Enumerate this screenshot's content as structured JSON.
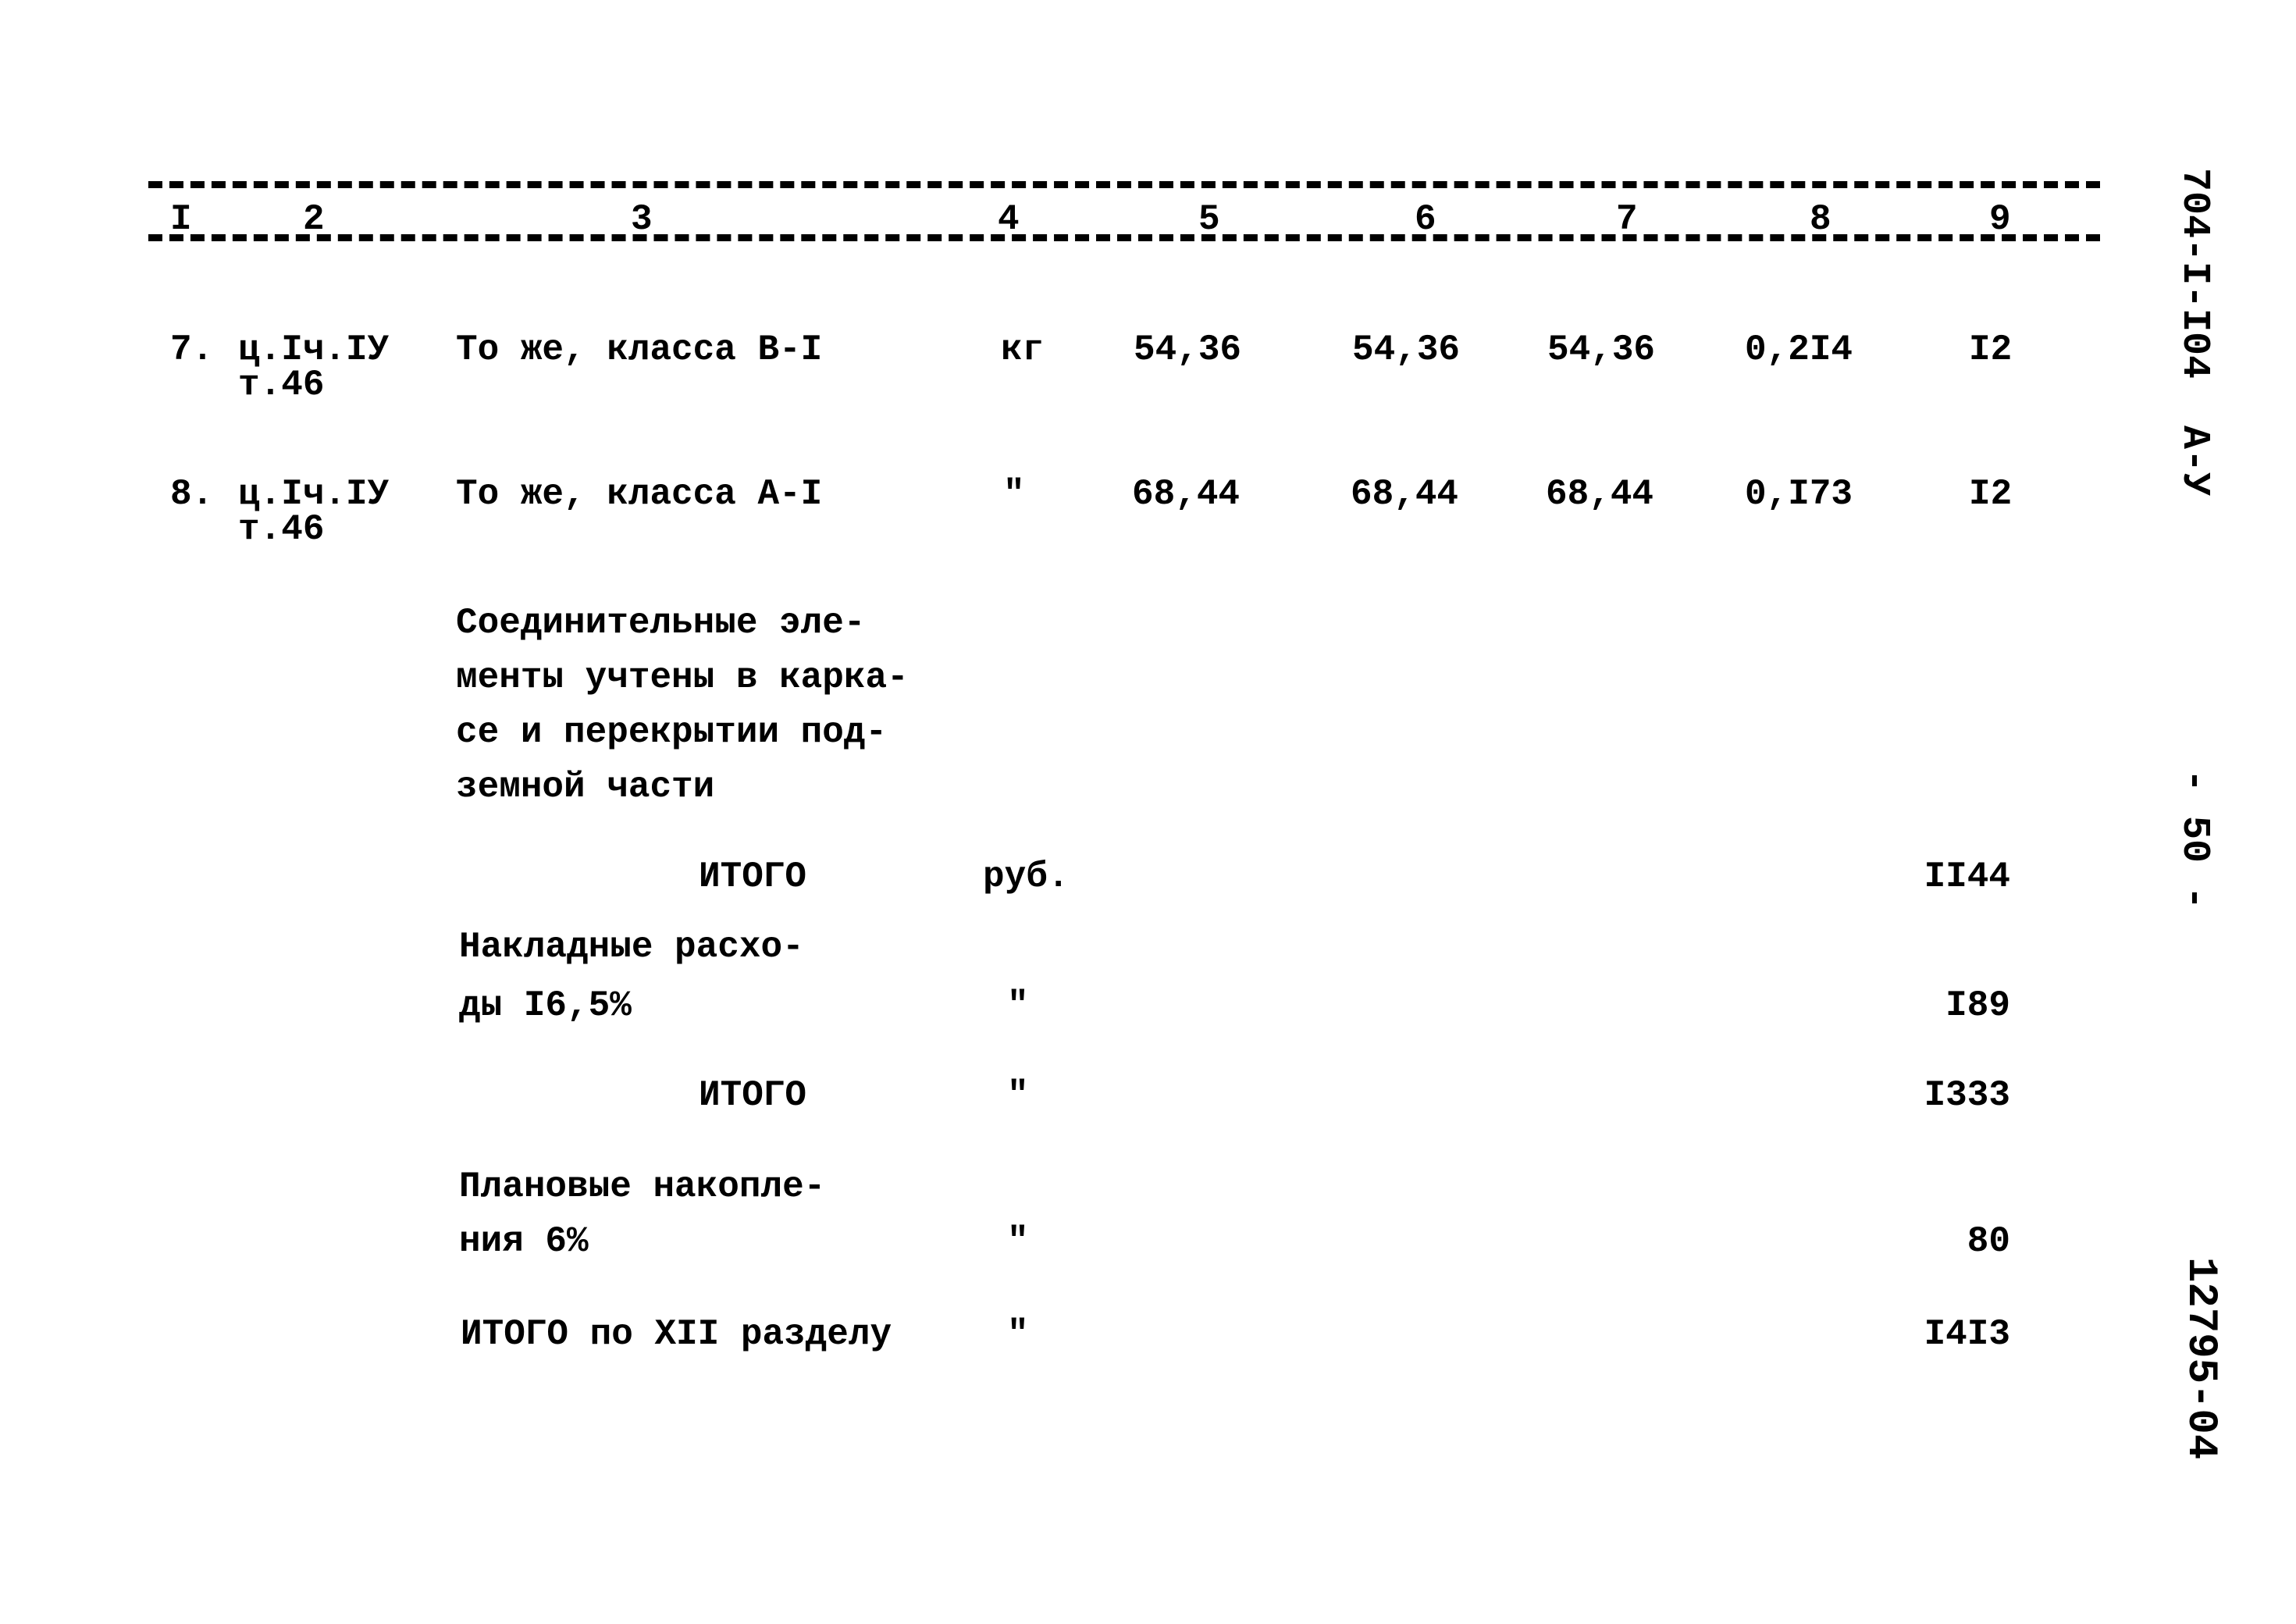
{
  "header": {
    "columns": [
      "I",
      "2",
      "3",
      "4",
      "5",
      "6",
      "7",
      "8",
      "9"
    ]
  },
  "rows": [
    {
      "num": "7.",
      "ref": "ц.Iч.IУ",
      "ref2": "т.46",
      "desc": "То же, класса В-I",
      "unit": "кг",
      "c5": "54,36",
      "c6": "54,36",
      "c7": "54,36",
      "c8": "0,2I4",
      "c9": "I2"
    },
    {
      "num": "8.",
      "ref": "ц.Iч.IУ",
      "ref2": "т.46",
      "desc": "То же, класса А-I",
      "unit": "\"",
      "c5": "68,44",
      "c6": "68,44",
      "c7": "68,44",
      "c8": "0,I73",
      "c9": "I2"
    }
  ],
  "note": [
    "Соединительные эле-",
    "менты учтены в карка-",
    "се и перекрытии под-",
    "земной части"
  ],
  "totals": [
    {
      "label": "ИТОГО",
      "unit": "руб.",
      "value": "II44"
    },
    {
      "label": [
        "Накладные расхо-",
        "ды I6,5%"
      ],
      "unit": "\"",
      "value": "I89"
    },
    {
      "label": "ИТОГО",
      "unit": "\"",
      "value": "I333"
    },
    {
      "label": [
        "Плановые накопле-",
        "ния 6%"
      ],
      "unit": "\"",
      "value": "80"
    },
    {
      "label": "ИТОГО по XII разделу",
      "unit": "\"",
      "value": "I4I3"
    }
  ],
  "margin": {
    "doc_code": "704-I-I04  А-У",
    "page": "- 50 -",
    "archive": "12795-04"
  }
}
